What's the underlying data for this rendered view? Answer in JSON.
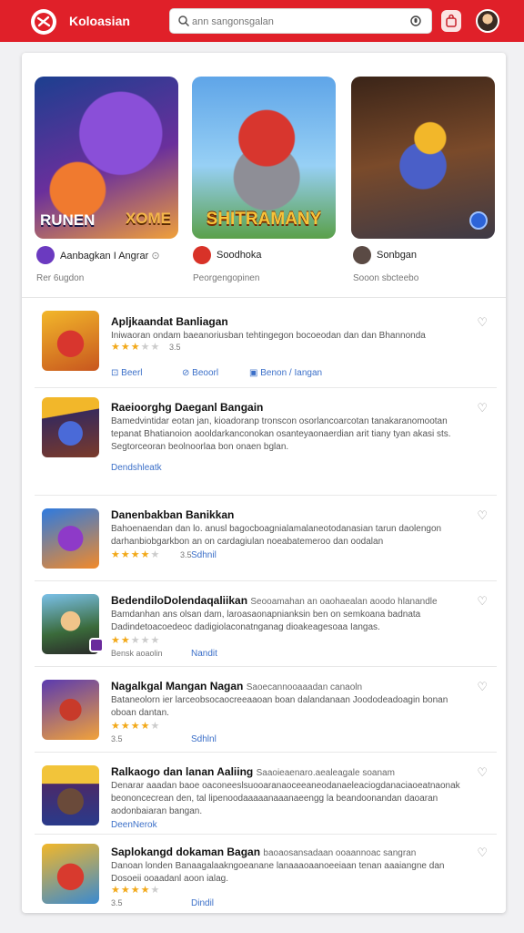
{
  "header": {
    "brand": "Koloasian",
    "search_placeholder": "ann sangonsgalan"
  },
  "featured": [
    {
      "art_title_left": "RUNEN",
      "art_title_right": "XOME",
      "name": "Aanbagkan I Angrar",
      "sub": "Rer 6ugdon"
    },
    {
      "art_title": "SHITRAMANY",
      "name": "Soodhoka",
      "sub": "Peorgengopinen"
    },
    {
      "name": "Sonbgan",
      "sub": "Sooon sbcteebo"
    }
  ],
  "list": [
    {
      "title": "Apljkaandat Banliagan",
      "desc": "Iniwaoran ondam baeanoriusban tehtingegon bocoeodan dan dan Bhannonda",
      "stars": 4,
      "score": "3.5",
      "links": [
        "Beerl",
        "Beoorl",
        "Benon / Iangan"
      ]
    },
    {
      "title": "Raeioorghg Daeganl Bangain",
      "desc": "Bamedvintidar eotan jan, kioadoranp tronscon osorlancoarcotan tanakaranomootan tepanat Bhatianoion aooldarkanconokan osanteyaonaerdian arit tiany tyan akasi sts. Segtorceoran beolnoorlaa bon onaen bglan.",
      "link": "Dendshleatk"
    },
    {
      "title": "Danenbakban Banikkan",
      "desc": "Bahoenaendan dan lo. anusl bagocboagnialamalaneotodanasian tarun daolengon darhanbiobgarkbon an on cardagiulan noeabatemeroo dan oodalan",
      "stars": 4,
      "score": "3.5",
      "link": "Sdhnil"
    },
    {
      "title": "BedendiloDolendaqaliikan",
      "title_tail": "Seooamahan an oaohaealan aoodo hlanandle",
      "desc": "Bamdanhan ans olsan dam, laroasaonapnianksin ben on semkoana badnata Dadindetoacoedeoc dadigiolaconatnganag dioakeagesoaa Iangas.",
      "stars": 2,
      "score": "Bensk aoaolin",
      "link": "Nandit"
    },
    {
      "title": "Nagalkgal Mangan Nagan",
      "title_tail": "Saoecannooaaadan canaoln",
      "desc": "Bataneolorn ier larceobsocaocreeaaoan boan dalandanaan Joododeadoagin bonan oboan dantan.",
      "stars": 4,
      "score": "3.5",
      "link": "Sdhlnl"
    },
    {
      "title": "Ralkaogo dan lanan Aaliing",
      "title_tail": "Saaoieaenaro.aealeagale soanam",
      "desc": "Denarar aaadan baoe oaconeeslsuooaranaoceeaneodanaeleaciogdanaciaoeatnaonak beononcecrean den, tal lipenoodaaaaanaaanaeengg la beandoonandan daoaran aodonbaiaran bangan.",
      "link": "DeenNerok"
    },
    {
      "title": "Saplokangd dokaman Bagan",
      "title_tail": "baoaosansadaan ooaannoac sangran",
      "desc": "Danoan londen Banaagalaakngoeanane lanaaaoaanoeeiaan tenan aaaiangne dan Dosoeii ooaadanl aoon ialag.",
      "stars": 4,
      "score": "3.5",
      "link": "Dindil"
    }
  ]
}
